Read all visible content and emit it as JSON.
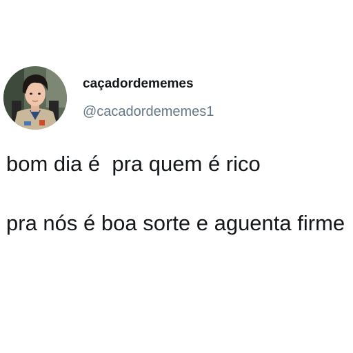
{
  "tweet": {
    "display_name": "caçadordememes",
    "handle": "@cacadordememes1",
    "paragraphs": [
      "bom dia é  pra quem é rico",
      "pra nós é boa sorte e aguenta firme"
    ]
  }
}
